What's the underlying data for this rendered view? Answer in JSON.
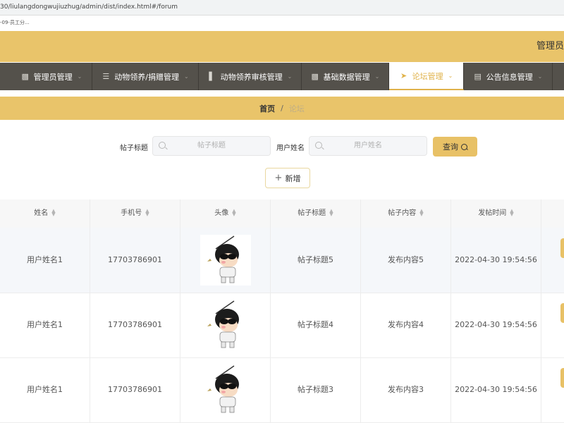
{
  "browser": {
    "url": "30/liulangdongwujiuzhug/admin/dist/index.html#/forum",
    "bookmark": "-09-员工分..."
  },
  "header": {
    "admin_label": "管理员"
  },
  "nav": {
    "items": [
      {
        "label": "管理员管理",
        "icon": "clipboard-icon"
      },
      {
        "label": "动物领养/捐赠管理",
        "icon": "list-icon"
      },
      {
        "label": "动物领养审核管理",
        "icon": "bar-chart-icon"
      },
      {
        "label": "基础数据管理",
        "icon": "clipboard-icon"
      },
      {
        "label": "论坛管理",
        "icon": "send-icon",
        "active": true
      },
      {
        "label": "公告信息管理",
        "icon": "doc-icon"
      }
    ]
  },
  "breadcrumb": {
    "home": "首页",
    "separator": "/",
    "current": "论坛"
  },
  "search": {
    "title_label": "帖子标题",
    "title_placeholder": "帖子标题",
    "user_label": "用户姓名",
    "user_placeholder": "用户姓名",
    "query_button": "查询"
  },
  "actions": {
    "add_button": "新增"
  },
  "table": {
    "columns": [
      "姓名",
      "手机号",
      "头像",
      "帖子标题",
      "帖子内容",
      "发帖时间"
    ],
    "rows": [
      {
        "name": "用户姓名1",
        "phone": "17703786901",
        "title": "帖子标题5",
        "content": "发布内容5",
        "time": "2022-04-30 19:54:56"
      },
      {
        "name": "用户姓名1",
        "phone": "17703786901",
        "title": "帖子标题4",
        "content": "发布内容4",
        "time": "2022-04-30 19:54:56"
      },
      {
        "name": "用户姓名1",
        "phone": "17703786901",
        "title": "帖子标题3",
        "content": "发布内容3",
        "time": "2022-04-30 19:54:56"
      }
    ]
  },
  "colors": {
    "accent": "#e9c46a",
    "nav_bg": "#54514b",
    "active_text": "#e0b24a"
  }
}
